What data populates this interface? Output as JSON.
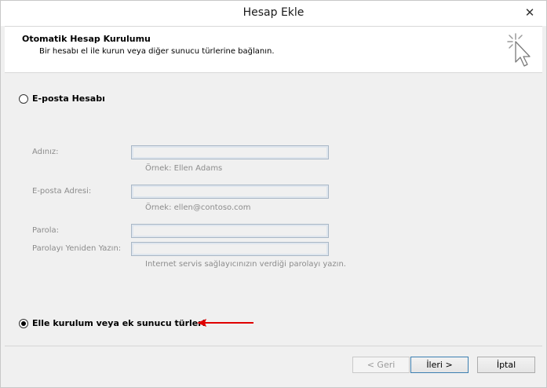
{
  "window": {
    "title": "Hesap Ekle",
    "close_glyph": "✕"
  },
  "header": {
    "title": "Otomatik Hesap Kurulumu",
    "subtitle": "Bir hesabı el ile kurun veya diğer sunucu türlerine bağlanın.",
    "icon": "wizard-cursor-icon"
  },
  "options": {
    "email_account": {
      "label": "E-posta Hesabı",
      "selected": false
    },
    "manual_setup": {
      "label": "Elle kurulum veya ek sunucu türleri",
      "selected": true
    }
  },
  "form": {
    "name": {
      "label": "Adınız:",
      "value": "",
      "hint": "Örnek: Ellen Adams"
    },
    "email": {
      "label": "E-posta Adresi:",
      "value": "",
      "hint": "Örnek: ellen@contoso.com"
    },
    "password": {
      "label": "Parola:",
      "value": ""
    },
    "password_confirm": {
      "label": "Parolayı Yeniden Yazın:",
      "value": "",
      "hint": "Internet servis sağlayıcınızın verdiği parolayı yazın."
    }
  },
  "buttons": {
    "back": "< Geri",
    "next": "İleri >",
    "cancel": "İptal"
  },
  "colors": {
    "annotation_arrow": "#e00000",
    "disabled_text": "#8c8c8c"
  }
}
